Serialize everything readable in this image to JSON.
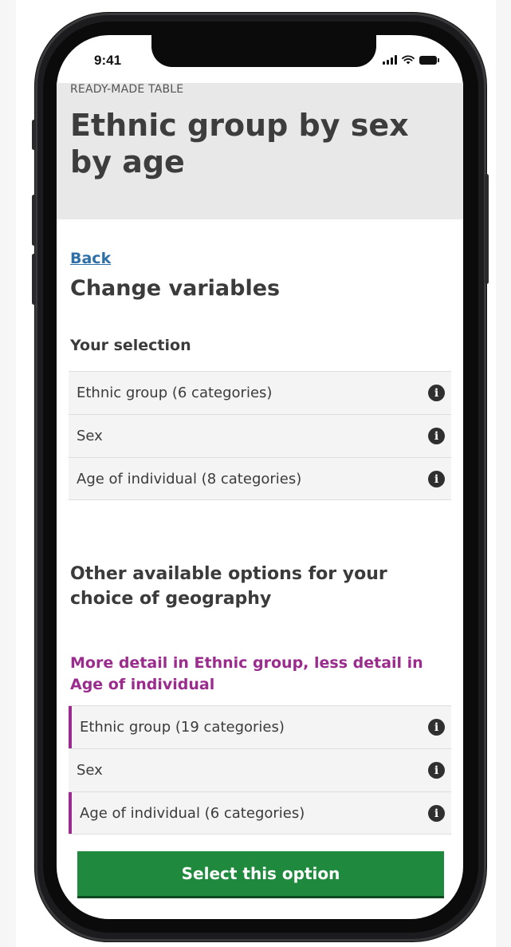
{
  "status_bar": {
    "time": "9:41"
  },
  "header": {
    "eyebrow": "READY-MADE TABLE",
    "title": "Ethnic group by sex by age"
  },
  "nav": {
    "back_label": "Back"
  },
  "main": {
    "heading": "Change variables",
    "selection_heading": "Your selection",
    "selection_rows": [
      {
        "label": "Ethnic group (6 categories)",
        "icon": "info-icon"
      },
      {
        "label": "Sex",
        "icon": "info-icon"
      },
      {
        "label": "Age of individual (8 categories)",
        "icon": "info-icon"
      }
    ],
    "other_heading": "Other available options for your choice of geography",
    "option": {
      "heading": "More detail in Ethnic group, less detail in Age of individual",
      "rows": [
        {
          "label": "Ethnic group (19 categories)",
          "highlighted": true,
          "icon": "info-icon"
        },
        {
          "label": "Sex",
          "highlighted": false,
          "icon": "info-icon"
        },
        {
          "label": "Age of individual (6 categories)",
          "highlighted": true,
          "icon": "info-icon"
        }
      ],
      "button_label": "Select this option"
    }
  },
  "colors": {
    "accent_purple": "#9b2c8e",
    "link_blue": "#2f6fa7",
    "button_green": "#1f8a3d",
    "header_band": "#e8e8e8"
  },
  "icons": {
    "info": "i"
  }
}
